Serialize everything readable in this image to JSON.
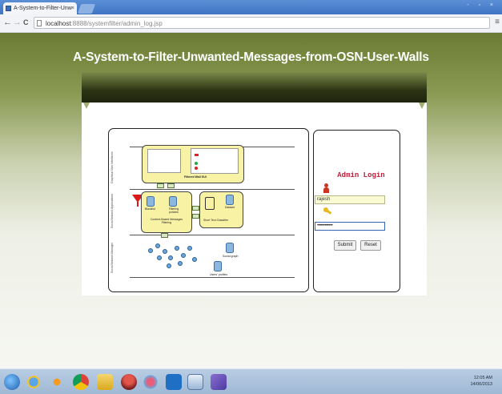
{
  "browser": {
    "tab_title": "A-System-to-Filter-Unw",
    "tab_close": "×",
    "window_controls": "- ▫ ×",
    "url_host": "localhost",
    "url_rest": ":8888/systemfilter/admin_log.jsp",
    "back_glyph": "←",
    "forward_glyph": "→",
    "reload_glyph": "C",
    "menu_glyph": "≡"
  },
  "site": {
    "title": "A-System-to-Filter-Unwanted-Messages-from-OSN-User-Walls"
  },
  "diagram": {
    "lane_labels": [
      "Graphical User Interfaces",
      "Social Network Applications",
      "Social Network Manager"
    ],
    "wall_label": "Filtered Wall GUI",
    "blacklist_label": "Blacklist",
    "filtering_policies_label": "Filtering policies",
    "stc_label": "Short Text Classifier",
    "cbmf_label": "Content-Based Messages Filtering",
    "dataset_label": "Dataset",
    "social_graph_label": "Social graph",
    "users_profiles_label": "Users' profiles"
  },
  "login": {
    "title": "Admin Login",
    "username_value": "rajesh",
    "password_value": "••••••••••••",
    "submit_label": "Submit",
    "reset_label": "Reset"
  },
  "taskbar": {
    "time": "12:05 AM",
    "date": "14/06/2013"
  },
  "colors": {
    "login_title": "#b5213a",
    "page_top": "#6b7b33",
    "taskbar": "#b9cde3"
  }
}
